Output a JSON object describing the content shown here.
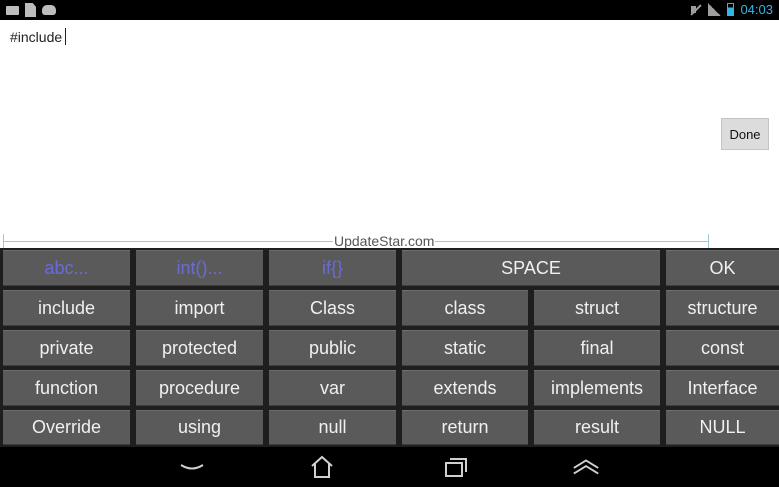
{
  "status_bar": {
    "time": "04:03",
    "left_icons": [
      "keyboard-icon",
      "document-icon",
      "cat-icon"
    ],
    "right_icons": [
      "mute-icon",
      "signal-icon",
      "battery-icon"
    ]
  },
  "editor": {
    "text": "#include",
    "done_label": "Done",
    "watermark": "UpdateStar.com"
  },
  "keyboard": {
    "rows": [
      [
        "abc...",
        "int()...",
        "if{}",
        "SPACE",
        "OK"
      ],
      [
        "include",
        "import",
        "Class",
        "class",
        "struct",
        "structure"
      ],
      [
        "private",
        "protected",
        "public",
        "static",
        "final",
        "const"
      ],
      [
        "function",
        "procedure",
        "var",
        "extends",
        "implements",
        "Interface"
      ],
      [
        "Override",
        "using",
        "null",
        "return",
        "result",
        "NULL"
      ]
    ]
  },
  "nav_bar": {
    "buttons": [
      "back-icon",
      "home-icon",
      "recent-apps-icon",
      "menu-up-icon"
    ]
  },
  "colors": {
    "accent": "#33b5e5",
    "key_bg": "#5a5a5a",
    "mode_key_text": "#6b6bd6"
  }
}
